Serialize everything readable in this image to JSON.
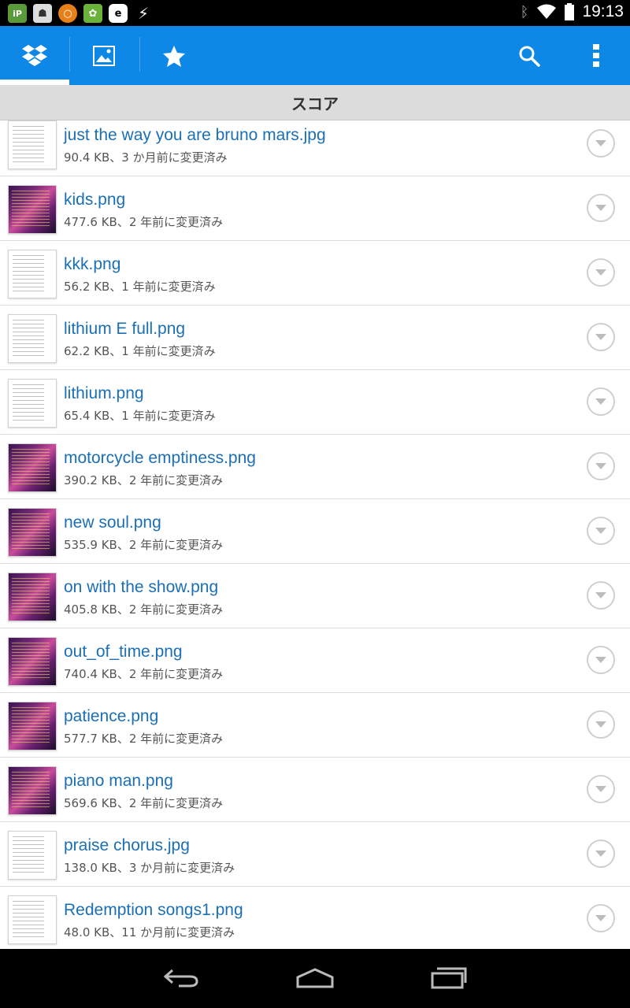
{
  "status_bar": {
    "time": "19:13",
    "notification_icons": [
      "ip-icon",
      "app-icon",
      "orange-ring-icon",
      "green-badge-icon",
      "e-icon",
      "lightning-icon"
    ]
  },
  "action_bar": {
    "tabs": [
      {
        "name": "dropbox-icon",
        "active": true
      },
      {
        "name": "photos-icon",
        "active": false
      },
      {
        "name": "favorites-icon",
        "active": false
      }
    ],
    "actions": [
      "search-icon",
      "overflow-menu-icon"
    ],
    "color": "#0d88e6"
  },
  "section": {
    "title": "スコア"
  },
  "files": [
    {
      "name": "just the way you are bruno mars.jpg",
      "meta": "90.4 KB、3 か月前に変更済み",
      "thumb": "doc"
    },
    {
      "name": "kids.png",
      "meta": "477.6 KB、2 年前に変更済み",
      "thumb": "photo"
    },
    {
      "name": "kkk.png",
      "meta": "56.2 KB、1 年前に変更済み",
      "thumb": "doc"
    },
    {
      "name": "lithium E full.png",
      "meta": "62.2 KB、1 年前に変更済み",
      "thumb": "doc"
    },
    {
      "name": "lithium.png",
      "meta": "65.4 KB、1 年前に変更済み",
      "thumb": "doc"
    },
    {
      "name": "motorcycle emptiness.png",
      "meta": "390.2 KB、2 年前に変更済み",
      "thumb": "photo"
    },
    {
      "name": "new soul.png",
      "meta": "535.9 KB、2 年前に変更済み",
      "thumb": "photo"
    },
    {
      "name": "on with the show.png",
      "meta": "405.8 KB、2 年前に変更済み",
      "thumb": "photo"
    },
    {
      "name": "out_of_time.png",
      "meta": "740.4 KB、2 年前に変更済み",
      "thumb": "photo"
    },
    {
      "name": "patience.png",
      "meta": "577.7 KB、2 年前に変更済み",
      "thumb": "photo"
    },
    {
      "name": "piano man.png",
      "meta": "569.6 KB、2 年前に変更済み",
      "thumb": "photo"
    },
    {
      "name": "praise chorus.jpg",
      "meta": "138.0 KB、3 か月前に変更済み",
      "thumb": "doc"
    },
    {
      "name": "Redemption songs1.png",
      "meta": "48.0 KB、11 か月前に変更済み",
      "thumb": "doc"
    }
  ],
  "nav_bar": {
    "buttons": [
      "back-icon",
      "home-icon",
      "recents-icon"
    ]
  }
}
